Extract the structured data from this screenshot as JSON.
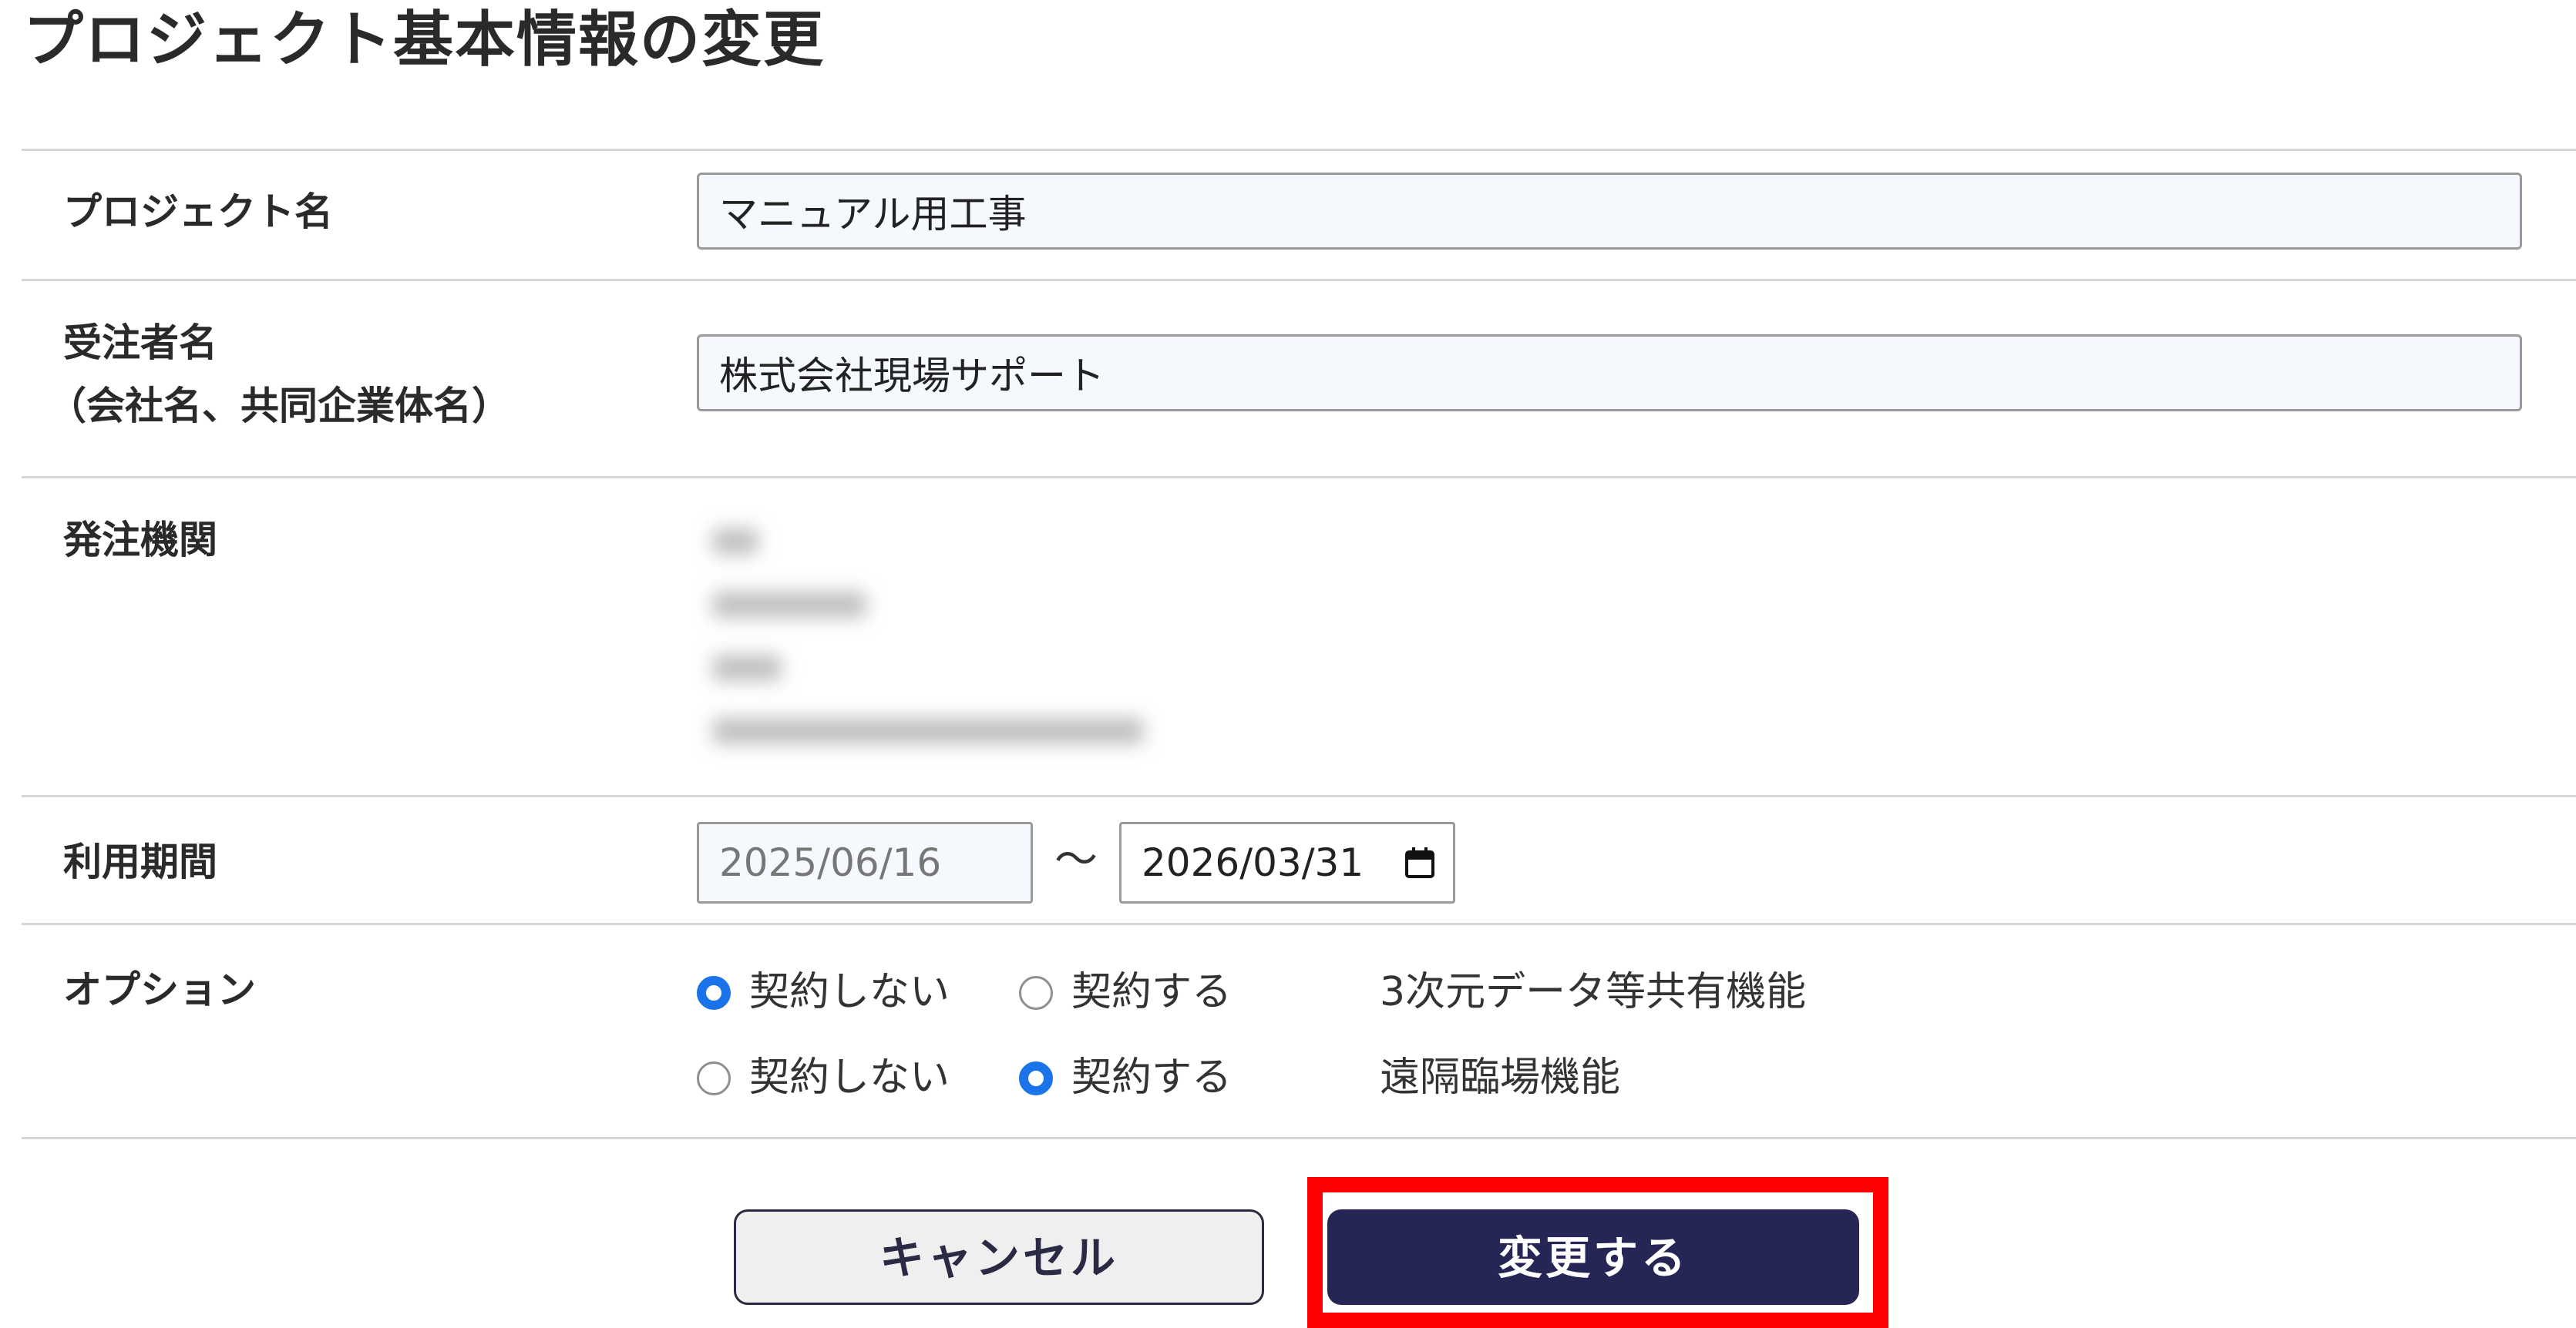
{
  "page": {
    "title": "プロジェクト基本情報の変更"
  },
  "form": {
    "project_name": {
      "label": "プロジェクト名",
      "value": "マニュアル用工事"
    },
    "contractor": {
      "label_line1": "受注者名",
      "label_line2": "（会社名、共同企業体名）",
      "value": "株式会社現場サポート"
    },
    "ordering_agency": {
      "label": "発注機関",
      "value_redacted": true
    },
    "usage_period": {
      "label": "利用期間",
      "start": "2025/06/16",
      "separator": "〜",
      "end": "2026/03/31"
    },
    "options": {
      "label": "オプション",
      "items": [
        {
          "name": "3次元データ等共有機能",
          "choices": [
            "契約しない",
            "契約する"
          ],
          "selected": "契約しない"
        },
        {
          "name": "遠隔臨場機能",
          "choices": [
            "契約しない",
            "契約する"
          ],
          "selected": "契約する"
        }
      ]
    }
  },
  "actions": {
    "cancel_label": "キャンセル",
    "submit_label": "変更する"
  },
  "colors": {
    "submit_bg": "#262656",
    "radio_accent": "#1a73e8",
    "highlight": "#ff0000",
    "input_bg": "#f5f9fe"
  },
  "icons": {
    "date_picker": "calendar-icon"
  }
}
